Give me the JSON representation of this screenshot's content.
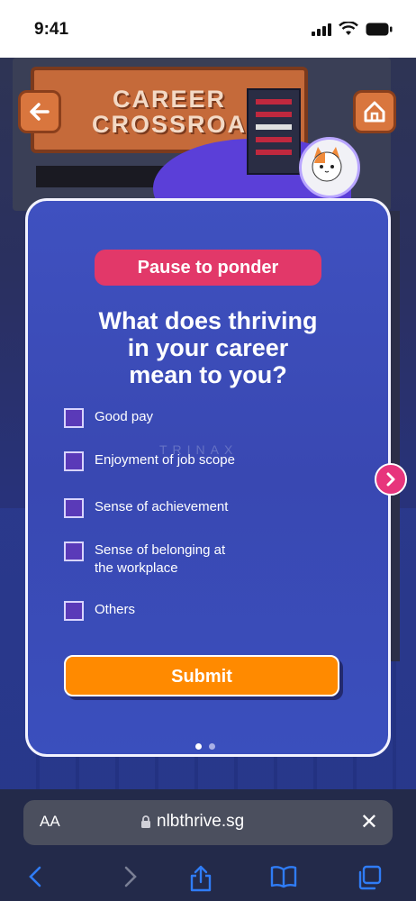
{
  "status_bar": {
    "time": "9:41"
  },
  "scene": {
    "sign_text": "CAREER\nCROSSROA"
  },
  "card": {
    "badge": "Pause to ponder",
    "question": "What does thriving\nin your career\nmean to you?",
    "watermark": "TRINAX",
    "options": [
      {
        "label": "Good pay",
        "checked": false
      },
      {
        "label": "Enjoyment of job scope",
        "checked": false
      },
      {
        "label": "Sense of achievement",
        "checked": false
      },
      {
        "label": "Sense of belonging at\nthe workplace",
        "checked": false
      },
      {
        "label": "Others",
        "checked": false
      }
    ],
    "submit_label": "Submit",
    "pagination": {
      "current": 1,
      "total": 2
    }
  },
  "browser": {
    "text_size_label": "AA",
    "url": "nlbthrive.sg"
  },
  "colors": {
    "card_bg": "#3f51c0",
    "badge": "#e23869",
    "submit": "#ff8a00",
    "checkbox": "#5a3ab8",
    "next_arrow": "#e7357c",
    "browser_blue": "#2f7cf6"
  }
}
